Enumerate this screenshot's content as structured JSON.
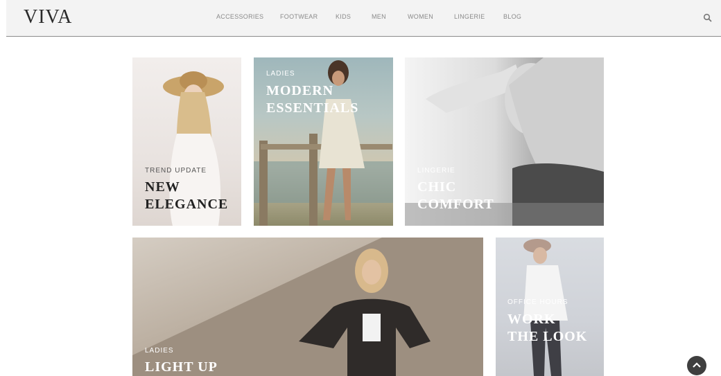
{
  "header": {
    "logo": "VIVA",
    "nav": [
      "ACCESSORIES",
      "FOOTWEAR",
      "KIDS",
      "MEN",
      "WOMEN",
      "LINGERIE",
      "BLOG"
    ],
    "search_icon": "search-icon"
  },
  "tiles": [
    {
      "kicker": "TREND UPDATE",
      "line1": "NEW",
      "line2": "ELEGANCE"
    },
    {
      "kicker": "LADIES",
      "line1": "MODERN",
      "line2": "ESSENTIALS"
    },
    {
      "kicker": "LINGERIE",
      "line1": "CHIC",
      "line2": "COMFORT"
    },
    {
      "kicker": "LADIES",
      "line1": "LIGHT UP",
      "line2": ""
    },
    {
      "kicker": "OFFICE HOURS",
      "line1": "WORK",
      "line2": "THE LOOK"
    }
  ],
  "back_to_top_icon": "chevron-up-icon",
  "colors": {
    "header_bg": "#f3f3f3",
    "nav_text": "#8a8a8a",
    "dark_text": "#2a2a2a",
    "light_text": "#ffffff"
  }
}
